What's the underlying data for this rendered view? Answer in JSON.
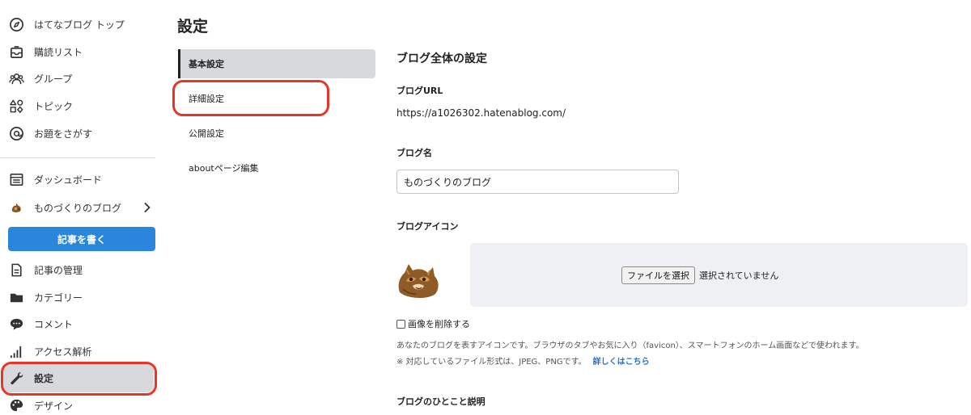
{
  "sidebar": {
    "top_items": [
      {
        "label": "はてなブログ トップ",
        "icon": "compass-icon"
      },
      {
        "label": "購読リスト",
        "icon": "inbox-icon"
      },
      {
        "label": "グループ",
        "icon": "group-icon"
      },
      {
        "label": "トピック",
        "icon": "shapes-icon"
      },
      {
        "label": "お題をさがす",
        "icon": "at-sign-icon"
      }
    ],
    "dashboard": {
      "label": "ダッシュボード",
      "icon": "dashboard-icon"
    },
    "blog_selector": {
      "label": "ものづくりのブログ",
      "icon": "blog-avatar-icon"
    },
    "write_button": "記事を書く",
    "bottom_items": [
      {
        "label": "記事の管理",
        "icon": "document-icon"
      },
      {
        "label": "カテゴリー",
        "icon": "folder-icon"
      },
      {
        "label": "コメント",
        "icon": "comment-icon"
      },
      {
        "label": "アクセス解析",
        "icon": "bar-signal-icon"
      },
      {
        "label": "設定",
        "icon": "wrench-icon",
        "active": true
      },
      {
        "label": "デザイン",
        "icon": "palette-icon"
      }
    ]
  },
  "settings": {
    "title": "設定",
    "menu": [
      {
        "label": "基本設定",
        "active": true
      },
      {
        "label": "詳細設定"
      },
      {
        "label": "公開設定"
      },
      {
        "label": "aboutページ編集"
      }
    ]
  },
  "main": {
    "section_title": "ブログ全体の設定",
    "blog_url_label": "ブログURL",
    "blog_url": "https://a1026302.hatenablog.com/",
    "blog_name_label": "ブログ名",
    "blog_name_value": "ものづくりのブログ",
    "blog_icon_label": "ブログアイコン",
    "file_button": "ファイルを選択",
    "file_status": "選択されていません",
    "delete_image_label": "画像を削除する",
    "icon_help": "あなたのブログを表すアイコンです。ブラウザのタブやお気に入り（favicon）、スマートフォンのホーム画面などで使われます。",
    "format_note": "※ 対応しているファイル形式は、JPEG、PNGです。",
    "more_link": "詳しくはこちら",
    "description_label": "ブログのひとこと説明"
  },
  "colors": {
    "accent_blue": "#2a86da",
    "highlight_red": "#e73528",
    "active_bg": "#d8d9dc",
    "link_blue": "#2a6fc9"
  }
}
